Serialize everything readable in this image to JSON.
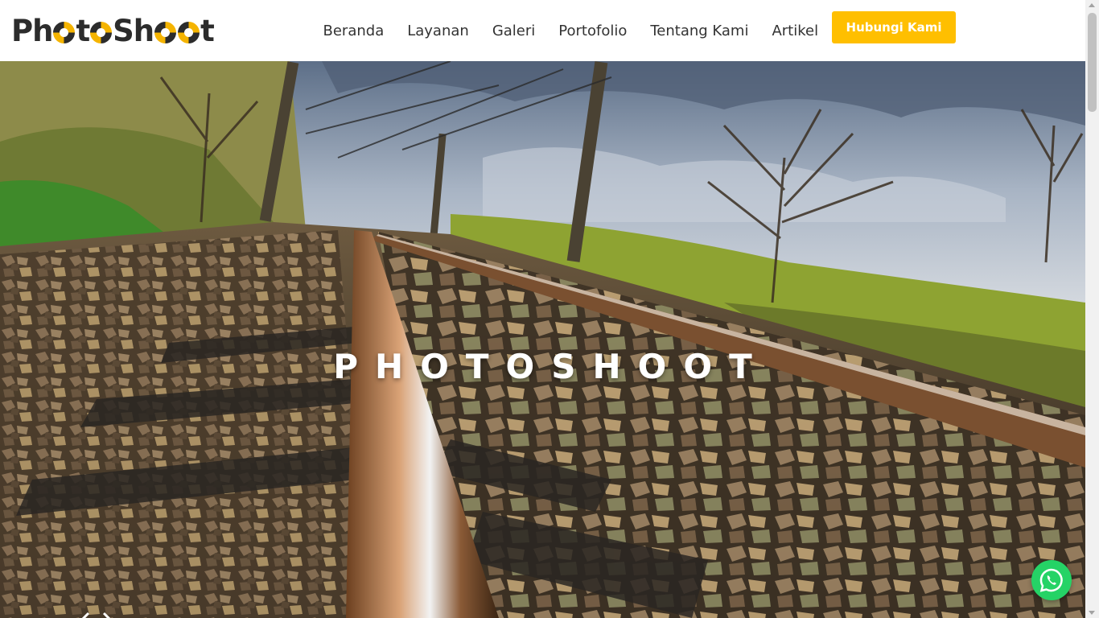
{
  "brand": {
    "logo_text": "PhotoShoot",
    "colors": {
      "accent": "#ffbf00",
      "whatsapp": "#25d366",
      "text": "#333333"
    }
  },
  "nav": {
    "items": [
      {
        "label": "Beranda"
      },
      {
        "label": "Layanan"
      },
      {
        "label": "Galeri"
      },
      {
        "label": "Portofolio"
      },
      {
        "label": "Tentang Kami"
      },
      {
        "label": "Artikel"
      }
    ],
    "cta_label": "Hubungi Kami"
  },
  "hero": {
    "title": "PHOTOSHOOT",
    "image_subject": "railway-track-hdr-photo",
    "prev_icon": "chevron-left-icon",
    "next_icon": "chevron-right-icon"
  },
  "floating": {
    "whatsapp_icon": "whatsapp-icon"
  }
}
